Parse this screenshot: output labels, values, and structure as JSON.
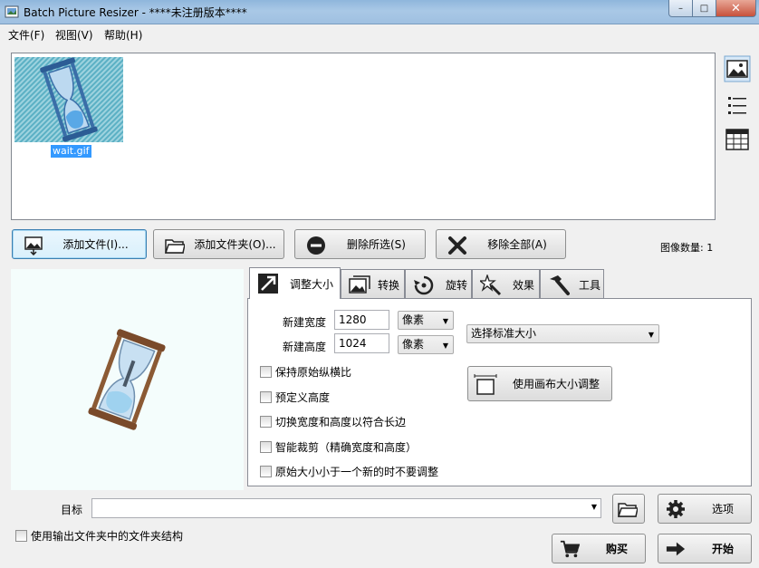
{
  "window": {
    "title": "Batch Picture Resizer - ****未注册版本****",
    "minimize": "–",
    "maximize": "□",
    "close": "✕"
  },
  "menu": [
    {
      "label": "文件(F)"
    },
    {
      "label": "视图(V)"
    },
    {
      "label": "帮助(H)"
    }
  ],
  "file_list": {
    "items": [
      {
        "name": "wait.gif",
        "icon": "hourglass-icon",
        "selected": true
      }
    ],
    "view_modes": [
      "thumbnail-view-icon",
      "list-view-icon",
      "grid-view-icon"
    ]
  },
  "buttons": {
    "add_files": "添加文件(I)...",
    "add_folder": "添加文件夹(O)...",
    "remove_selected": "删除所选(S)",
    "remove_all": "移除全部(A)",
    "buy": "购买",
    "start": "开始",
    "options": "选项"
  },
  "image_count": "图像数量: 1",
  "tabs": [
    {
      "label": "调整大小",
      "icon": "resize-icon",
      "active": true
    },
    {
      "label": "转换",
      "icon": "convert-icon"
    },
    {
      "label": "旋转",
      "icon": "rotate-icon"
    },
    {
      "label": "效果",
      "icon": "effects-icon"
    },
    {
      "label": "工具",
      "icon": "tools-icon"
    }
  ],
  "resize": {
    "width_label": "新建宽度",
    "width_value": "1280",
    "height_label": "新建高度",
    "height_value": "1024",
    "unit_width": "像素",
    "unit_height": "像素",
    "standard_size": "选择标准大小",
    "canvas_resize_button": "使用画布大小调整",
    "checkboxes": [
      {
        "label": "保持原始纵横比",
        "checked": false
      },
      {
        "label": "预定义高度",
        "checked": false
      },
      {
        "label": "切换宽度和高度以符合长边",
        "checked": false
      },
      {
        "label": "智能裁剪（精确宽度和高度）",
        "checked": false
      },
      {
        "label": "原始大小小于一个新的时不要调整",
        "checked": false
      }
    ]
  },
  "output": {
    "target_label": "目标",
    "target_value": "",
    "folder_structure_label": "使用输出文件夹中的文件夹结构",
    "folder_structure_checked": false
  },
  "colors": {
    "selection": "#3399ff",
    "title_bar": "#a9c8e6",
    "preview_bg": "#f4fdfc"
  }
}
